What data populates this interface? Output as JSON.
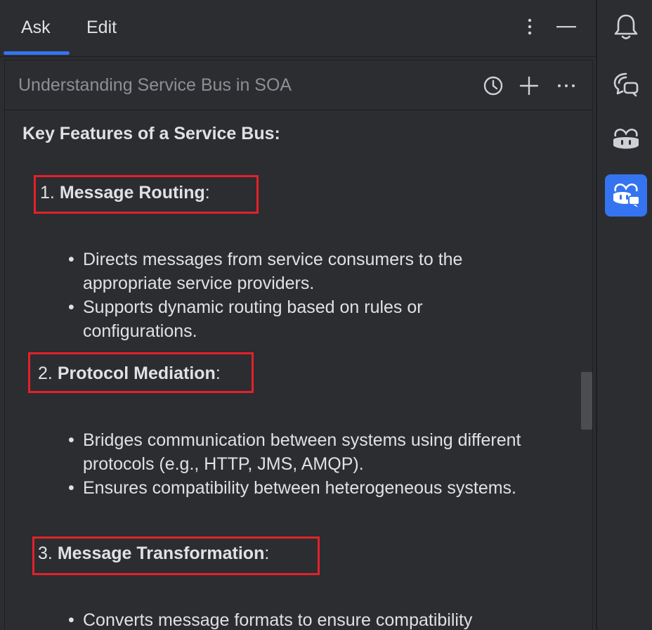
{
  "tabs": {
    "ask": "Ask",
    "edit": "Edit"
  },
  "chat": {
    "title": "Understanding Service Bus in SOA"
  },
  "content": {
    "heading": "Key Features of a Service Bus:",
    "features": [
      {
        "number": "1.",
        "name": "Message Routing",
        "suffix": ":",
        "bullets": [
          "Directs messages from service consumers to the appropriate service providers.",
          "Supports dynamic routing based on rules or configurations."
        ]
      },
      {
        "number": "2.",
        "name": "Protocol Mediation",
        "suffix": ":",
        "bullets": [
          "Bridges communication between systems using different protocols (e.g., HTTP, JMS, AMQP).",
          "Ensures compatibility between heterogeneous systems."
        ]
      },
      {
        "number": "3.",
        "name": "Message Transformation",
        "suffix": ":",
        "bullets": [
          "Converts message formats to ensure compatibility"
        ]
      }
    ]
  },
  "colors": {
    "background": "#2b2d30",
    "text": "#dfe1e5",
    "muted_text": "#8c8f94",
    "accent": "#3574f0",
    "highlight_border": "#e3212b"
  },
  "icons": {
    "tab_more": "vertical-ellipsis-icon",
    "tab_minimize": "minimize-icon",
    "history": "clock-icon",
    "new_chat": "plus-icon",
    "options": "horizontal-ellipsis-icon",
    "notifications": "bell-icon",
    "ai_chat": "chat-bubble-icon",
    "copilot": "copilot-icon",
    "copilot_chat": "copilot-chat-icon"
  }
}
